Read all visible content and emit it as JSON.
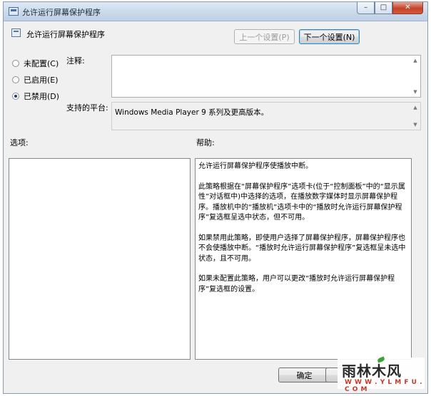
{
  "window": {
    "title": "允许运行屏幕保护程序",
    "controls": {
      "minimize": "–",
      "maximize": "□",
      "close": "✕"
    }
  },
  "header": {
    "policy_title": "允许运行屏幕保护程序",
    "prev_button": "上一个设置(P)",
    "next_button": "下一个设置(N)"
  },
  "options": [
    {
      "label": "未配置(C)",
      "checked": false
    },
    {
      "label": "已启用(E)",
      "checked": false
    },
    {
      "label": "已禁用(D)",
      "checked": true
    }
  ],
  "comment": {
    "label": "注释:",
    "value": ""
  },
  "platform": {
    "label": "支持的平台:",
    "value": "Windows Media Player 9 系列及更高版本。"
  },
  "options_section": {
    "label": "选项:"
  },
  "help_section": {
    "label": "帮助:",
    "paragraphs": [
      "允许运行屏幕保护程序使播放中断。",
      "此策略根据在“屏幕保护程序”选项卡(位于“控制面板”中的“显示属性”对话框中)中选择的选项，在播放数字媒体时显示屏幕保护程序。播放机中的“播放机”选项卡中的“播放时允许运行屏幕保护程序”复选框呈选中状态，但不可用。",
      "如果禁用此策略，即使用户选择了屏幕保护程序，屏幕保护程序也不会使播放中断。“播放时允许运行屏幕保护程序”复选框呈未选中状态，且不可用。",
      "如果未配置此策略，用户可以更改“播放时允许运行屏幕保护程序”复选框的设置。"
    ]
  },
  "footer": {
    "ok_button": "确定"
  },
  "watermark": {
    "main": "雨林木风",
    "sub": "W W W . Y L M F U . C O M"
  }
}
